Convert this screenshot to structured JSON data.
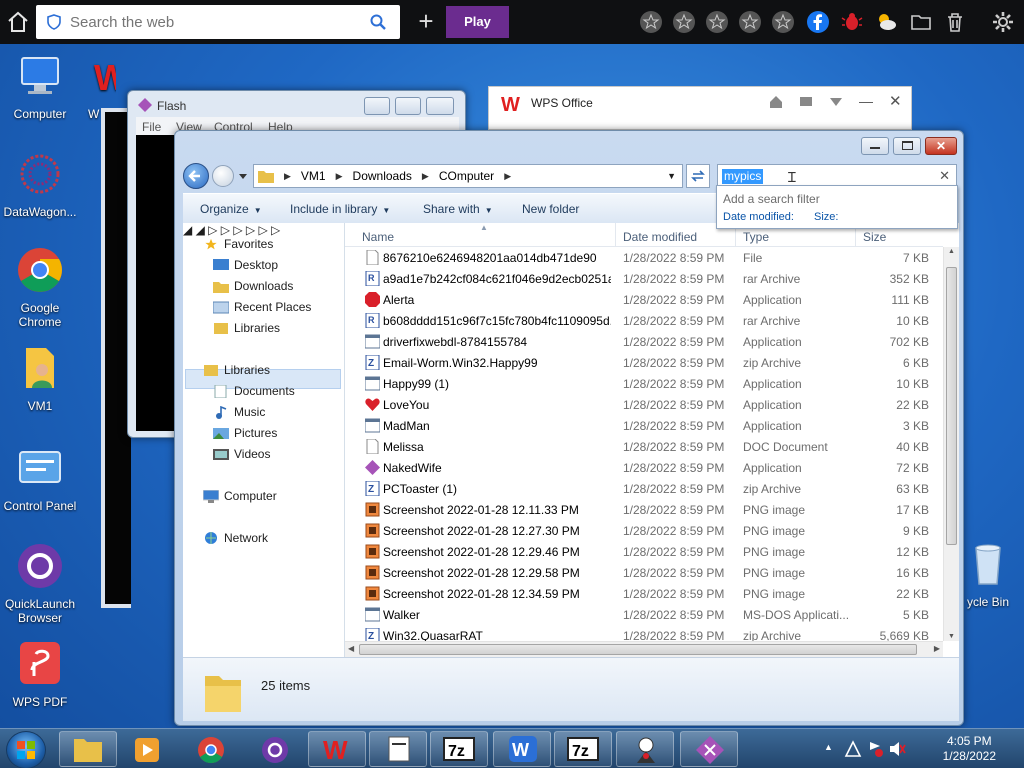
{
  "topbar": {
    "search_placeholder": "Search the web",
    "play_label": "Play",
    "plus_label": "+"
  },
  "desktop": {
    "icons": [
      {
        "label": "Computer"
      },
      {
        "label": "W"
      },
      {
        "label": "DataWagon..."
      },
      {
        "label": "Google Chrome"
      },
      {
        "label": "VM1"
      },
      {
        "label": "Control Panel"
      },
      {
        "label": "QuickLaunch Browser"
      },
      {
        "label": "WPS PDF"
      },
      {
        "label": "ycle Bin"
      }
    ]
  },
  "flash_window": {
    "title": "Flash",
    "menu": [
      "File",
      "View",
      "Control",
      "Help"
    ]
  },
  "wps_window": {
    "title": "WPS Office"
  },
  "explorer": {
    "address": [
      "VM1",
      "Downloads",
      "COmputer"
    ],
    "search_value": "mypics",
    "filter_popup": {
      "title": "Add a search filter",
      "options": [
        "Date modified:",
        "Size:"
      ]
    },
    "commands": [
      {
        "label": "Organize",
        "has_arrow": true
      },
      {
        "label": "Include in library",
        "has_arrow": true
      },
      {
        "label": "Share with",
        "has_arrow": true
      },
      {
        "label": "New folder",
        "has_arrow": false
      }
    ],
    "nav": {
      "favorites": "Favorites",
      "favorite_items": [
        "Desktop",
        "Downloads",
        "Recent Places",
        "Libraries"
      ],
      "libraries": "Libraries",
      "library_items": [
        "Documents",
        "Music",
        "Pictures",
        "Videos"
      ],
      "computer": "Computer",
      "network": "Network"
    },
    "columns": {
      "name": "Name",
      "date": "Date modified",
      "type": "Type",
      "size": "Size"
    },
    "files": [
      {
        "name": "8676210e6246948201aa014db471de90",
        "date": "1/28/2022 8:59 PM",
        "type": "File",
        "size": "7 KB",
        "icon": "blank"
      },
      {
        "name": "a9ad1e7b242cf084c621f046e9d2ecb0251a...",
        "date": "1/28/2022 8:59 PM",
        "type": "rar Archive",
        "size": "352 KB",
        "icon": "rar"
      },
      {
        "name": "Alerta",
        "date": "1/28/2022 8:59 PM",
        "type": "Application",
        "size": "111 KB",
        "icon": "stop"
      },
      {
        "name": "b608dddd151c96f7c15fc780b4fc1109095d...",
        "date": "1/28/2022 8:59 PM",
        "type": "rar Archive",
        "size": "10 KB",
        "icon": "rar"
      },
      {
        "name": "driverfixwebdl-8784155784",
        "date": "1/28/2022 8:59 PM",
        "type": "Application",
        "size": "702 KB",
        "icon": "app"
      },
      {
        "name": "Email-Worm.Win32.Happy99",
        "date": "1/28/2022 8:59 PM",
        "type": "zip Archive",
        "size": "6 KB",
        "icon": "zip"
      },
      {
        "name": "Happy99 (1)",
        "date": "1/28/2022 8:59 PM",
        "type": "Application",
        "size": "10 KB",
        "icon": "app"
      },
      {
        "name": "LoveYou",
        "date": "1/28/2022 8:59 PM",
        "type": "Application",
        "size": "22 KB",
        "icon": "heart"
      },
      {
        "name": "MadMan",
        "date": "1/28/2022 8:59 PM",
        "type": "Application",
        "size": "3 KB",
        "icon": "app"
      },
      {
        "name": "Melissa",
        "date": "1/28/2022 8:59 PM",
        "type": "DOC Document",
        "size": "40 KB",
        "icon": "blank"
      },
      {
        "name": "NakedWife",
        "date": "1/28/2022 8:59 PM",
        "type": "Application",
        "size": "72 KB",
        "icon": "diamond"
      },
      {
        "name": "PCToaster (1)",
        "date": "1/28/2022 8:59 PM",
        "type": "zip Archive",
        "size": "63 KB",
        "icon": "zip"
      },
      {
        "name": "Screenshot 2022-01-28 12.11.33 PM",
        "date": "1/28/2022 8:59 PM",
        "type": "PNG image",
        "size": "17 KB",
        "icon": "png"
      },
      {
        "name": "Screenshot 2022-01-28 12.27.30 PM",
        "date": "1/28/2022 8:59 PM",
        "type": "PNG image",
        "size": "9 KB",
        "icon": "png"
      },
      {
        "name": "Screenshot 2022-01-28 12.29.46 PM",
        "date": "1/28/2022 8:59 PM",
        "type": "PNG image",
        "size": "12 KB",
        "icon": "png"
      },
      {
        "name": "Screenshot 2022-01-28 12.29.58 PM",
        "date": "1/28/2022 8:59 PM",
        "type": "PNG image",
        "size": "16 KB",
        "icon": "png"
      },
      {
        "name": "Screenshot 2022-01-28 12.34.59 PM",
        "date": "1/28/2022 8:59 PM",
        "type": "PNG image",
        "size": "22 KB",
        "icon": "png"
      },
      {
        "name": "Walker",
        "date": "1/28/2022 8:59 PM",
        "type": "MS-DOS Applicati...",
        "size": "5 KB",
        "icon": "app"
      },
      {
        "name": "Win32.QuasarRAT",
        "date": "1/28/2022 8:59 PM",
        "type": "zip Archive",
        "size": "5,669 KB",
        "icon": "zip"
      }
    ],
    "item_count": "25 items"
  },
  "taskbar": {
    "time": "4:05 PM",
    "date": "1/28/2022",
    "items": [
      "explorer",
      "media",
      "chrome",
      "quicklaunch",
      "wps",
      "notepad",
      "7zip",
      "wps-writer",
      "7zip-2",
      "java",
      "flash"
    ]
  },
  "colors": {
    "accent": "#3399ff",
    "play": "#6b2c8f",
    "link": "#0a54a8"
  }
}
